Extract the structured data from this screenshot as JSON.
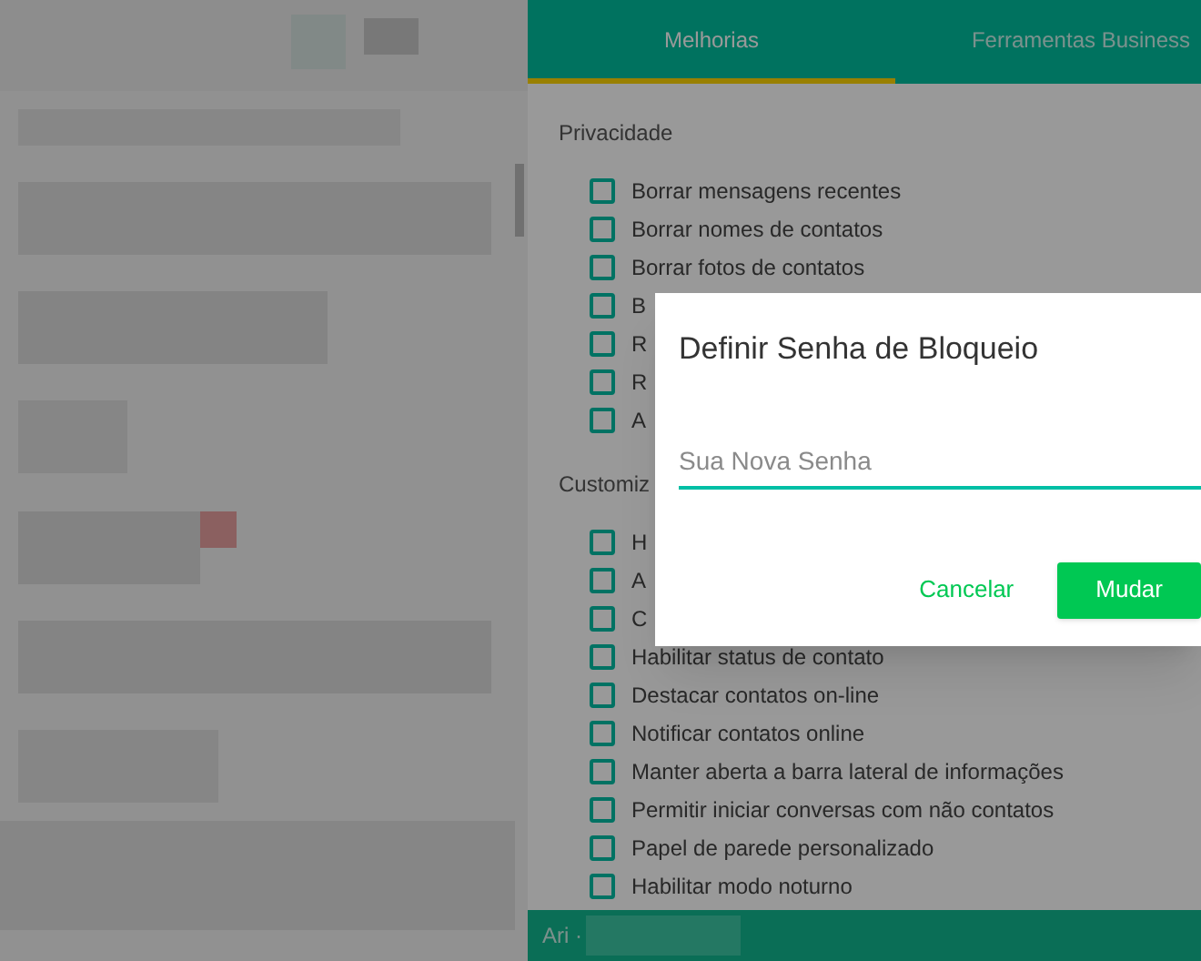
{
  "tabs": [
    {
      "label": "Melhorias",
      "selected": true
    },
    {
      "label": "Ferramentas Business",
      "selected": false
    }
  ],
  "sections": [
    {
      "title": "Privacidade",
      "options": [
        {
          "label": "Borrar mensagens recentes",
          "checked": false
        },
        {
          "label": "Borrar nomes de contatos",
          "checked": false
        },
        {
          "label": "Borrar fotos de contatos",
          "checked": false
        },
        {
          "label": "B",
          "checked": false
        },
        {
          "label": "R",
          "checked": false
        },
        {
          "label": "R",
          "checked": false
        },
        {
          "label": "A",
          "checked": false
        }
      ]
    },
    {
      "title": "Customiz",
      "options": [
        {
          "label": "H",
          "checked": false
        },
        {
          "label": "A",
          "checked": false
        },
        {
          "label": "C",
          "checked": false
        },
        {
          "label": "Habilitar status de contato",
          "checked": false
        },
        {
          "label": "Destacar contatos on-line",
          "checked": false
        },
        {
          "label": "Notificar contatos online",
          "checked": false
        },
        {
          "label": "Manter aberta a barra lateral de informações",
          "checked": false
        },
        {
          "label": "Permitir iniciar conversas com não contatos",
          "checked": false
        },
        {
          "label": "Papel de parede personalizado",
          "checked": false
        },
        {
          "label": "Habilitar modo noturno",
          "checked": false
        }
      ]
    }
  ],
  "footer": {
    "text": "Ari ·"
  },
  "dialog": {
    "title": "Definir Senha de Bloqueio",
    "field": {
      "placeholder": "Sua Nova Senha"
    },
    "buttons": [
      {
        "label": "Cancelar",
        "kind": "text"
      },
      {
        "label": "Mudar",
        "kind": "primary"
      }
    ]
  }
}
